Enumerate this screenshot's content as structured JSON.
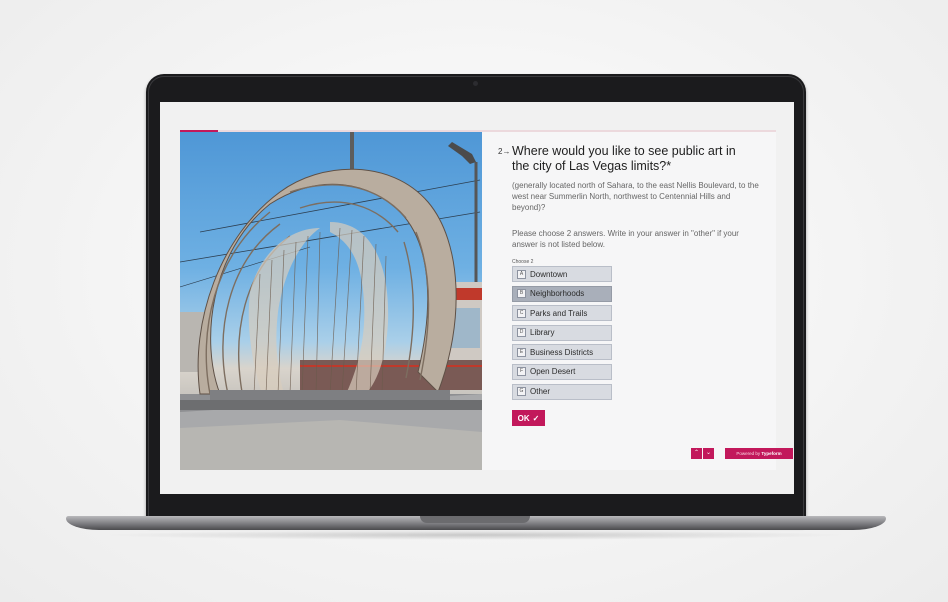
{
  "question": {
    "number": "2→",
    "title": "Where would you like to see public art in the city of Las Vegas limits?*",
    "description": "(generally located north of Sahara, to the east Nellis Boulevard, to the west near Summerlin North, northwest to Centennial Hills and beyond)?",
    "instructions": "Please choose 2 answers. Write in your answer in \"other\" if your answer is not listed below.",
    "choose_label": "Choose 2"
  },
  "choices": [
    {
      "key": "A",
      "label": "Downtown"
    },
    {
      "key": "B",
      "label": "Neighborhoods",
      "selected": true
    },
    {
      "key": "C",
      "label": "Parks and Trails"
    },
    {
      "key": "D",
      "label": "Library"
    },
    {
      "key": "E",
      "label": "Business Districts"
    },
    {
      "key": "F",
      "label": "Open Desert"
    },
    {
      "key": "G",
      "label": "Other"
    }
  ],
  "ok_button": {
    "label": "OK",
    "icon": "check-icon"
  },
  "footer": {
    "up_icon": "chevron-up-icon",
    "down_icon": "chevron-down-icon",
    "powered_prefix": "Powered by",
    "powered_brand": "Typeform"
  },
  "colors": {
    "accent": "#c2185b",
    "choice_bg": "#d8dbe1",
    "choice_selected_bg": "#a9afba"
  }
}
